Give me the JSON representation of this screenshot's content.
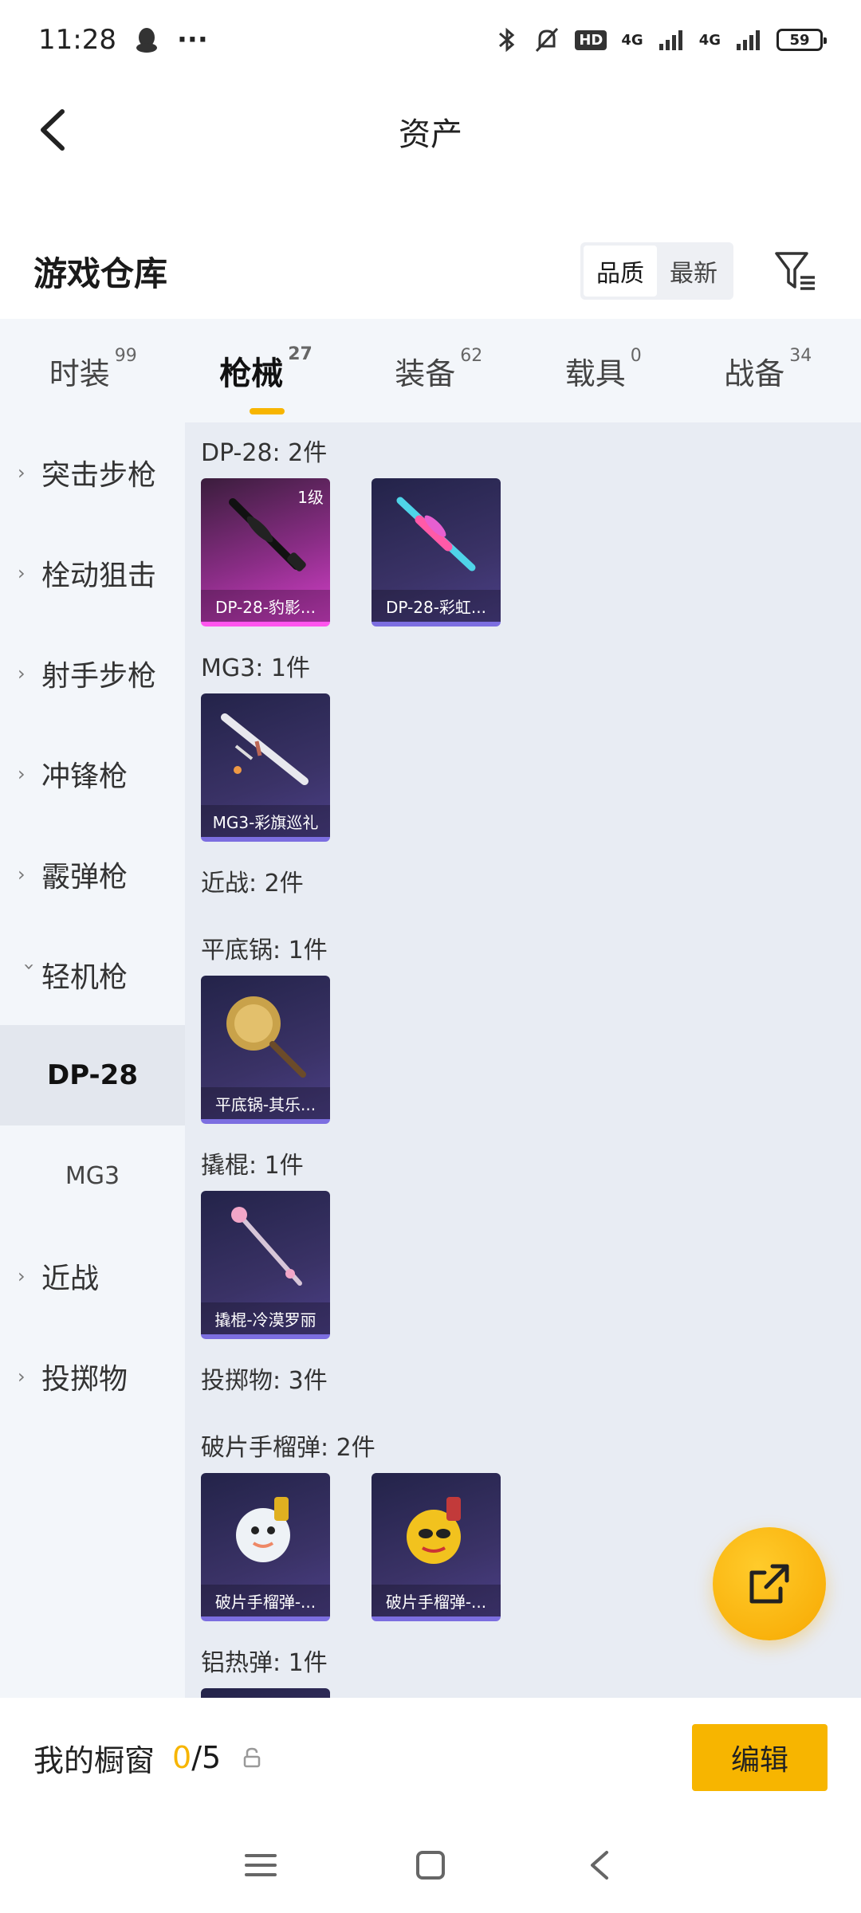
{
  "status_bar": {
    "time": "11:28",
    "more": "···",
    "hd_label": "HD",
    "net1": "4G",
    "net2": "4G",
    "battery": "59"
  },
  "header": {
    "title": "资产"
  },
  "warehouse": {
    "title": "游戏仓库",
    "sort_quality": "品质",
    "sort_newest": "最新"
  },
  "tabs": [
    {
      "label": "时装",
      "count": "99"
    },
    {
      "label": "枪械",
      "count": "27"
    },
    {
      "label": "装备",
      "count": "62"
    },
    {
      "label": "载具",
      "count": "0"
    },
    {
      "label": "战备",
      "count": "34"
    }
  ],
  "sidebar": {
    "items": [
      {
        "label": "突击步枪"
      },
      {
        "label": "栓动狙击"
      },
      {
        "label": "射手步枪"
      },
      {
        "label": "冲锋枪"
      },
      {
        "label": "霰弹枪"
      },
      {
        "label": "轻机枪"
      }
    ],
    "sub_items": [
      {
        "label": "DP-28"
      },
      {
        "label": "MG3"
      }
    ],
    "items_after": [
      {
        "label": "近战"
      },
      {
        "label": "投掷物"
      }
    ]
  },
  "content": {
    "sections": [
      {
        "title": "DP-28: 2件",
        "cards": [
          {
            "name": "DP-28-豹影...",
            "level": "1级",
            "rarity": "pink"
          },
          {
            "name": "DP-28-彩虹..."
          }
        ]
      },
      {
        "title": "MG3: 1件",
        "cards": [
          {
            "name": "MG3-彩旗巡礼"
          }
        ]
      },
      {
        "title": "近战: 2件",
        "cards": []
      },
      {
        "title": "平底锅: 1件",
        "cards": [
          {
            "name": "平底锅-其乐..."
          }
        ]
      },
      {
        "title": "撬棍: 1件",
        "cards": [
          {
            "name": "撬棍-冷漠罗丽"
          }
        ]
      },
      {
        "title": "投掷物: 3件",
        "cards": []
      },
      {
        "title": "破片手榴弹: 2件",
        "cards": [
          {
            "name": "破片手榴弹-..."
          },
          {
            "name": "破片手榴弹-..."
          }
        ]
      },
      {
        "title": "铝热弹: 1件",
        "cards": []
      }
    ]
  },
  "bottom_bar": {
    "title": "我的橱窗",
    "used": "0",
    "separator_total": "/5",
    "edit_label": "编辑"
  },
  "colors": {
    "accent": "#f7b500",
    "panel_bg": "#f3f6fa",
    "content_bg": "#e8ecf3"
  }
}
